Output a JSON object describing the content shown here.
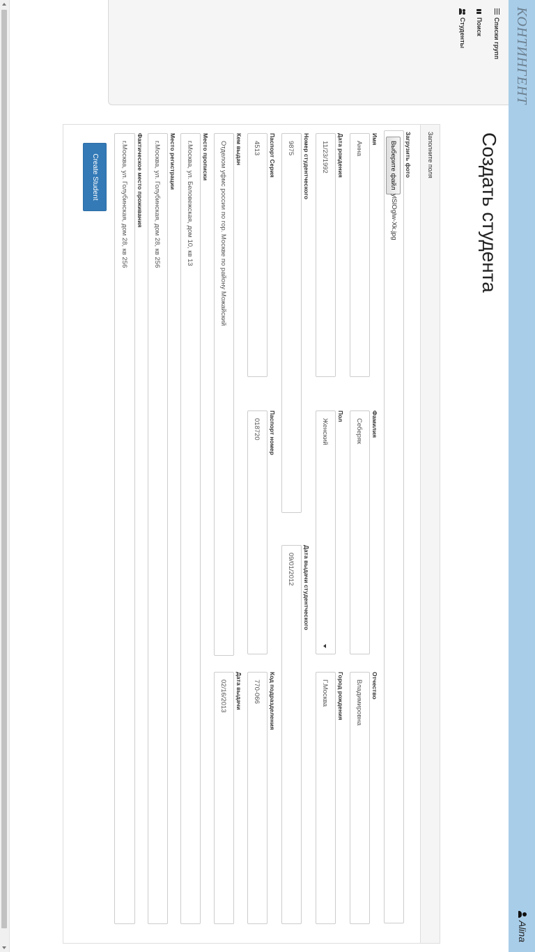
{
  "app": {
    "brand": "КОНТИНГЕНТ",
    "user_name": "Alina"
  },
  "menu": {
    "items": [
      {
        "label": "Списки групп",
        "icon": "list-icon"
      },
      {
        "label": "Поиск",
        "icon": "binoculars-icon"
      },
      {
        "label": "Студенты",
        "icon": "users-icon"
      }
    ]
  },
  "page": {
    "title": "Создать студента",
    "panel_heading": "Заполните поля"
  },
  "form": {
    "photo_label": "Загрузить фото",
    "photo_button": "Выберите файл",
    "photo_file": "ylSlOglw-Xk.jpg",
    "first_name_label": "Имя",
    "first_name": "Анна",
    "last_name_label": "Фамилия",
    "last_name": "Себеряк",
    "patronymic_label": "Отчество",
    "patronymic": "Владимировна",
    "birth_date_label": "Дата рождения",
    "birth_date": "11/23/1992",
    "gender_label": "Пол",
    "gender": "Женский",
    "birth_city_label": "Город рождения",
    "birth_city": "Г.Москва",
    "student_card_label": "Номер студентческого",
    "student_card": "9875",
    "student_card_date_label": "Дата выдачи студентческого",
    "student_card_date": "09/01/2012",
    "passport_series_label": "Паспорт Серия",
    "passport_series": "4513",
    "passport_number_label": "Паспорт номер",
    "passport_number": "018720",
    "division_code_label": "Код подразделения",
    "division_code": "770-066",
    "issued_by_label": "Кем выдан",
    "issued_by": "Отделом уфмс россии по гор. Москве по району Можайский",
    "issue_date_label": "Дата выдачи",
    "issue_date": "02/16/2013",
    "registration_label": "Место прописки",
    "registration": "г.Москва, ул. Беловежская, дом 10, кв 13",
    "reg_place_label": "Место регистрации",
    "reg_place": "г.Москва, ул. Голубинская, дом 28, кв 256",
    "actual_address_label": "Фактическое место проживания",
    "actual_address": "г.Москва, ул. Голубинская, дом 28, кв 256",
    "submit_label": "Create Student"
  }
}
